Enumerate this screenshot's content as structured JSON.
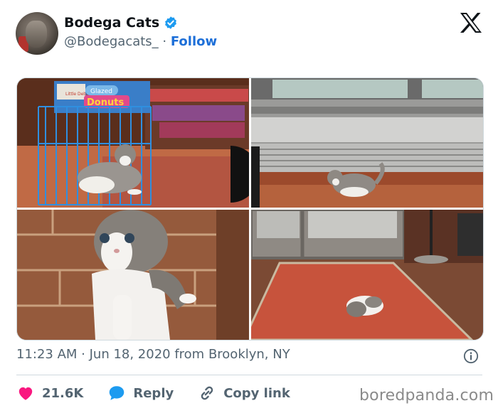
{
  "header": {
    "display_name": "Bodega Cats",
    "handle": "@Bodegacats_",
    "separator": " · ",
    "follow_label": "Follow"
  },
  "media": {
    "photos": [
      {
        "shop_sign": "Glazed",
        "shop_sign_2": "Donuts",
        "small_box": "Little Debbie"
      },
      {},
      {},
      {}
    ]
  },
  "meta": {
    "timestamp": "11:23 AM · Jun 18, 2020 from Brooklyn, NY"
  },
  "actions": {
    "likes_count": "21.6K",
    "reply_label": "Reply",
    "copy_link_label": "Copy link"
  },
  "watermark": "boredpanda.com",
  "colors": {
    "accent": "#1d6fd8",
    "like": "#f91880",
    "reply": "#1d9bf0",
    "text_secondary": "#536471"
  },
  "icons": {
    "verified": "verified-badge-icon",
    "platform": "x-logo-icon",
    "info": "info-icon",
    "like": "heart-icon",
    "reply": "speech-bubble-icon",
    "copy": "link-icon"
  }
}
